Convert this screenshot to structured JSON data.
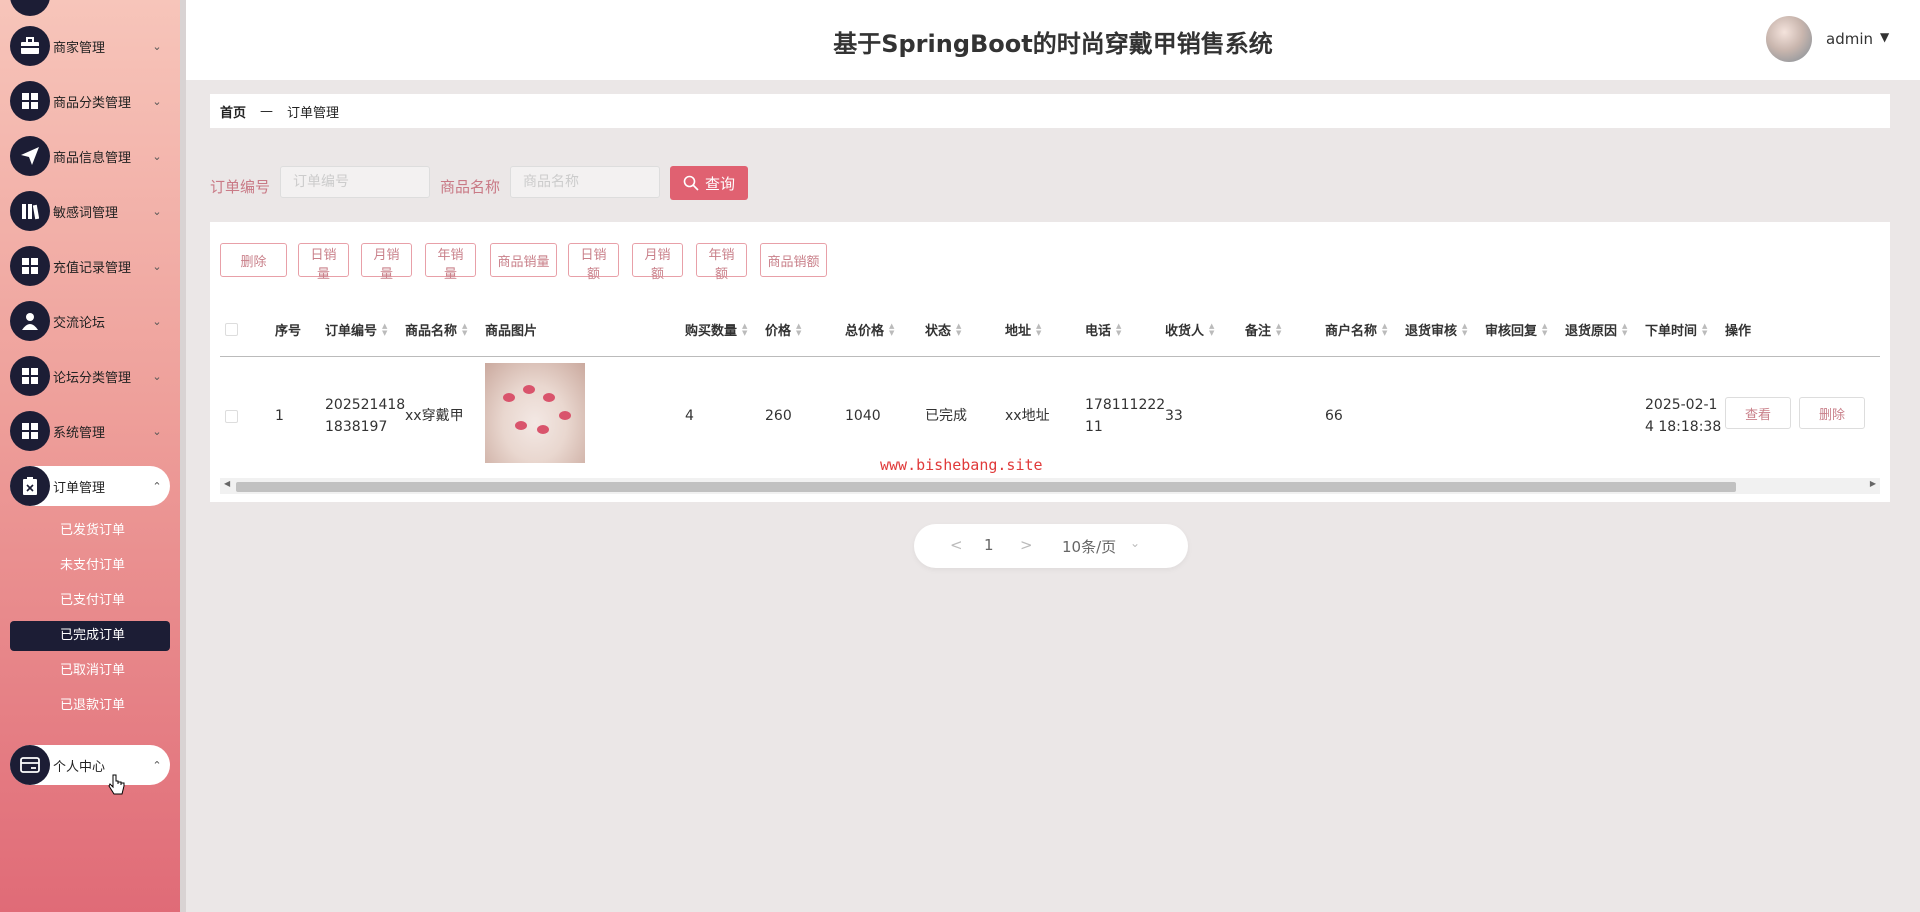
{
  "header": {
    "title": "基于SpringBoot的时尚穿戴甲销售系统",
    "user": "admin",
    "caret": "▼"
  },
  "sidebar": {
    "items": [
      {
        "label": "商家管理",
        "icon": "briefcase-icon",
        "chev": "⌄"
      },
      {
        "label": "商品分类管理",
        "icon": "grid-icon",
        "chev": "⌄"
      },
      {
        "label": "商品信息管理",
        "icon": "send-icon",
        "chev": "⌄"
      },
      {
        "label": "敏感词管理",
        "icon": "books-icon",
        "chev": "⌄"
      },
      {
        "label": "充值记录管理",
        "icon": "grid-icon",
        "chev": "⌄"
      },
      {
        "label": "交流论坛",
        "icon": "user-icon",
        "chev": "⌄"
      },
      {
        "label": "论坛分类管理",
        "icon": "grid-icon",
        "chev": "⌄"
      },
      {
        "label": "系统管理",
        "icon": "grid-icon",
        "chev": "⌄"
      },
      {
        "label": "订单管理",
        "icon": "clipboard-icon",
        "chev": "⌃"
      },
      {
        "label": "个人中心",
        "icon": "card-icon",
        "chev": "⌃"
      }
    ],
    "order_sub": [
      "已发货订单",
      "未支付订单",
      "已支付订单",
      "已完成订单",
      "已取消订单",
      "已退款订单"
    ]
  },
  "breadcrumb": {
    "home": "首页",
    "sep": "—",
    "current": "订单管理"
  },
  "search": {
    "order_no_label": "订单编号",
    "order_no_placeholder": "订单编号",
    "product_label": "商品名称",
    "product_placeholder": "商品名称",
    "button": "查询"
  },
  "toolbar": [
    "删除",
    "日销量",
    "月销量",
    "年销量",
    "商品销量",
    "日销额",
    "月销额",
    "年销额",
    "商品销额"
  ],
  "table": {
    "columns": [
      "序号",
      "订单编号",
      "商品名称",
      "商品图片",
      "购买数量",
      "价格",
      "总价格",
      "状态",
      "地址",
      "电话",
      "收货人",
      "备注",
      "商户名称",
      "退货审核",
      "审核回复",
      "退货原因",
      "下单时间",
      "操作"
    ],
    "rows": [
      {
        "index": "1",
        "order_no_1": "202521418",
        "order_no_2": "1838197",
        "product": "xx穿戴甲",
        "qty": "4",
        "price": "260",
        "total": "1040",
        "status": "已完成",
        "address": "xx地址",
        "phone_1": "178111222",
        "phone_2": "11",
        "receiver": "33",
        "remark": "",
        "merchant": "66",
        "return_review": "",
        "review_reply": "",
        "return_reason": "",
        "time_1": "2025-02-1",
        "time_2": "4 18:18:38",
        "view_btn": "查看",
        "delete_btn": "删除"
      }
    ]
  },
  "watermark": "www.bishebang.site",
  "pagination": {
    "prev": "<",
    "page": "1",
    "next": ">",
    "size": "10条/页",
    "size_caret": "⌄"
  },
  "colors": {
    "accent": "#e06171",
    "sidebar_dark": "#1c1d35",
    "link_text": "#c9808a"
  }
}
